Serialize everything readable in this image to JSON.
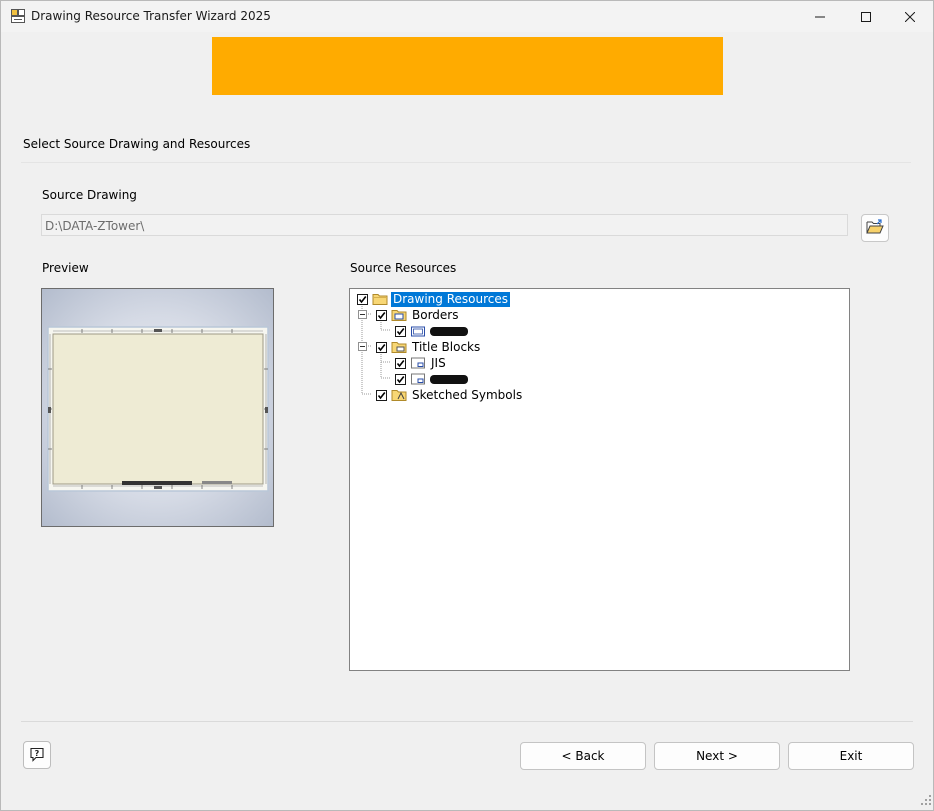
{
  "window": {
    "title": "Drawing Resource Transfer Wizard 2025",
    "controls": [
      "minimize",
      "maximize",
      "close"
    ]
  },
  "banner": {
    "color": "#ffab00"
  },
  "step": {
    "title": "Select Source Drawing and Resources"
  },
  "source": {
    "label": "Source Drawing",
    "path": "D:\\DATA-ZTower\\",
    "browse_icon": "folder-open-icon"
  },
  "preview": {
    "label": "Preview"
  },
  "resources": {
    "label": "Source Resources",
    "tree": [
      {
        "label": "Drawing Resources",
        "checked": true,
        "selected": true,
        "icon": "folder-icon"
      },
      {
        "label": "Borders",
        "checked": true,
        "expanded": true,
        "icon": "borders-folder-icon"
      },
      {
        "label": "",
        "checked": true,
        "icon": "border-item-icon",
        "redacted": true
      },
      {
        "label": "Title Blocks",
        "checked": true,
        "expanded": true,
        "icon": "titleblocks-folder-icon"
      },
      {
        "label": "JIS",
        "checked": true,
        "icon": "titleblock-item-icon"
      },
      {
        "label": "",
        "checked": true,
        "icon": "titleblock-item-icon",
        "redacted": true
      },
      {
        "label": "Sketched Symbols",
        "checked": true,
        "icon": "symbols-folder-icon"
      }
    ]
  },
  "buttons": {
    "help_icon": "help-icon",
    "back": "< Back",
    "next": "Next >",
    "exit": "Exit"
  },
  "colors": {
    "selection": "#0078d7",
    "banner": "#ffab00"
  }
}
